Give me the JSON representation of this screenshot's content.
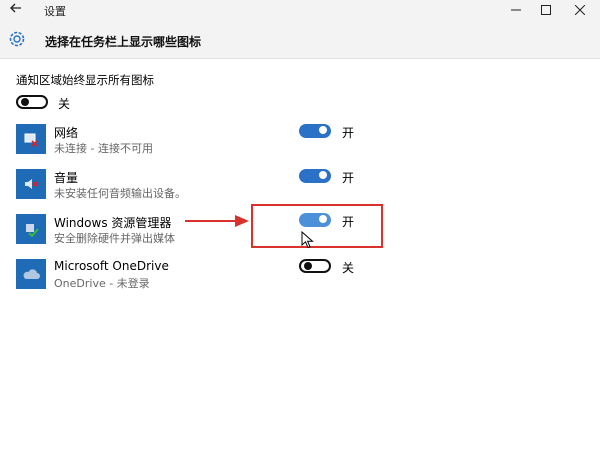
{
  "window": {
    "title": "设置",
    "back_icon": "back-arrow-icon",
    "minimize_icon": "minimize-icon",
    "maximize_icon": "maximize-icon",
    "close_icon": "close-icon"
  },
  "header": {
    "title": "选择在任务栏上显示哪些图标",
    "icon": "gear-icon"
  },
  "always_show": {
    "label": "通知区域始终显示所有图标",
    "state": "关",
    "on": false
  },
  "apps": [
    {
      "name": "网络",
      "subtitle": "未连接 - 连接不可用",
      "state": "开",
      "on": true,
      "icon": "network-icon"
    },
    {
      "name": "音量",
      "subtitle": "未安装任何音频输出设备。",
      "state": "开",
      "on": true,
      "icon": "volume-icon"
    },
    {
      "name": "Windows 资源管理器",
      "subtitle": "安全删除硬件并弹出媒体",
      "state": "开",
      "on": true,
      "icon": "safely-remove-hardware-icon"
    },
    {
      "name": "Microsoft OneDrive",
      "subtitle": "OneDrive - 未登录",
      "state": "关",
      "on": false,
      "icon": "onedrive-icon"
    }
  ],
  "colors": {
    "accent": "#2a71c7",
    "highlight": "#d9322c",
    "icon_bg": "#1f6bb5"
  }
}
